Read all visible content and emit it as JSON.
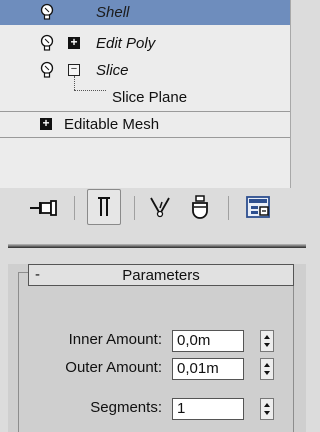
{
  "stack": {
    "items": [
      {
        "label": "Shell",
        "italic": true,
        "selected": true
      },
      {
        "label": "Edit Poly",
        "italic": true
      },
      {
        "label": "Slice",
        "italic": true
      },
      {
        "label": "Slice Plane",
        "italic": false
      },
      {
        "label": "Editable Mesh",
        "italic": false
      }
    ]
  },
  "toolbar": {
    "icons": [
      "pin-stack-icon",
      "show-end-result-icon",
      "make-unique-icon",
      "remove-modifier-icon",
      "configure-modifier-sets-icon"
    ]
  },
  "parameters": {
    "title": "Parameters",
    "collapse_symbol": "-",
    "inner_label": "Inner Amount:",
    "inner_value": "0,0m",
    "outer_label": "Outer Amount:",
    "outer_value": "0,01m",
    "segments_label": "Segments:",
    "segments_value": "1"
  },
  "colors": {
    "selection": "#6e8dbd",
    "panel": "#ececec",
    "rollout_bg": "#cfcfcf"
  }
}
